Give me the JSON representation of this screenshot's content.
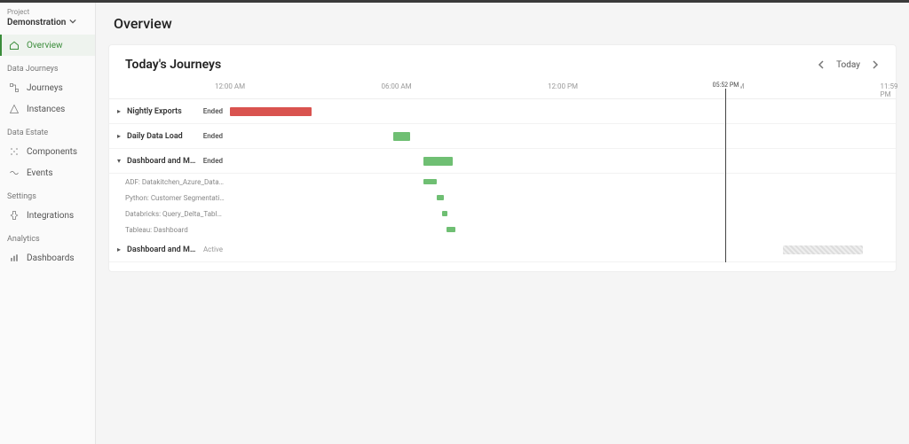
{
  "sidebar": {
    "project_label": "Project",
    "project_name": "Demonstration",
    "sections": {
      "data_journeys": "Data Journeys",
      "data_estate": "Data Estate",
      "settings": "Settings",
      "analytics": "Analytics"
    },
    "nav": {
      "overview": "Overview",
      "journeys": "Journeys",
      "instances": "Instances",
      "components": "Components",
      "events": "Events",
      "integrations": "Integrations",
      "dashboards": "Dashboards"
    }
  },
  "page": {
    "title": "Overview"
  },
  "card": {
    "title": "Today's Journeys",
    "date_label": "Today"
  },
  "timeline": {
    "ticks": [
      "12:00 AM",
      "06:00 AM",
      "12:00 PM",
      "06:00 PM",
      "11:59 PM"
    ],
    "now_label": "05:52 PM",
    "now_pct": 74.4,
    "rows": [
      {
        "type": "main",
        "expander": "▸",
        "name": "Nightly Exports",
        "status": "Ended",
        "bar": {
          "left": 0,
          "width": 12.2,
          "color": "red"
        }
      },
      {
        "type": "main",
        "expander": "▸",
        "name": "Daily Data Load",
        "status": "Ended",
        "bar": {
          "left": 24.5,
          "width": 2.6,
          "color": "green"
        }
      },
      {
        "type": "main",
        "expander": "▾",
        "name": "Dashboard and Mode…",
        "status": "Ended",
        "bar": {
          "left": 29.0,
          "width": 4.4,
          "color": "green"
        }
      },
      {
        "type": "sub",
        "name": "ADF: Datakitchen_Azure_Data_Facto…",
        "bar": {
          "left": 29.0,
          "width": 2.0,
          "color": "green"
        }
      },
      {
        "type": "sub",
        "name": "Python: Customer Segmentation",
        "bar": {
          "left": 31.0,
          "width": 1.1,
          "color": "green"
        }
      },
      {
        "type": "sub",
        "name": "Databricks: Query_Delta_Table_Note…",
        "bar": {
          "left": 31.8,
          "width": 0.9,
          "color": "green"
        }
      },
      {
        "type": "sub",
        "name": "Tableau: Dashboard",
        "bar": {
          "left": 32.6,
          "width": 1.3,
          "color": "green"
        }
      },
      {
        "type": "main",
        "expander": "▸",
        "name": "Dashboard and Mode…",
        "status": "Active",
        "status_class": "active",
        "bar": {
          "left": 83.0,
          "width": 12.0,
          "color": "grey"
        }
      }
    ]
  }
}
